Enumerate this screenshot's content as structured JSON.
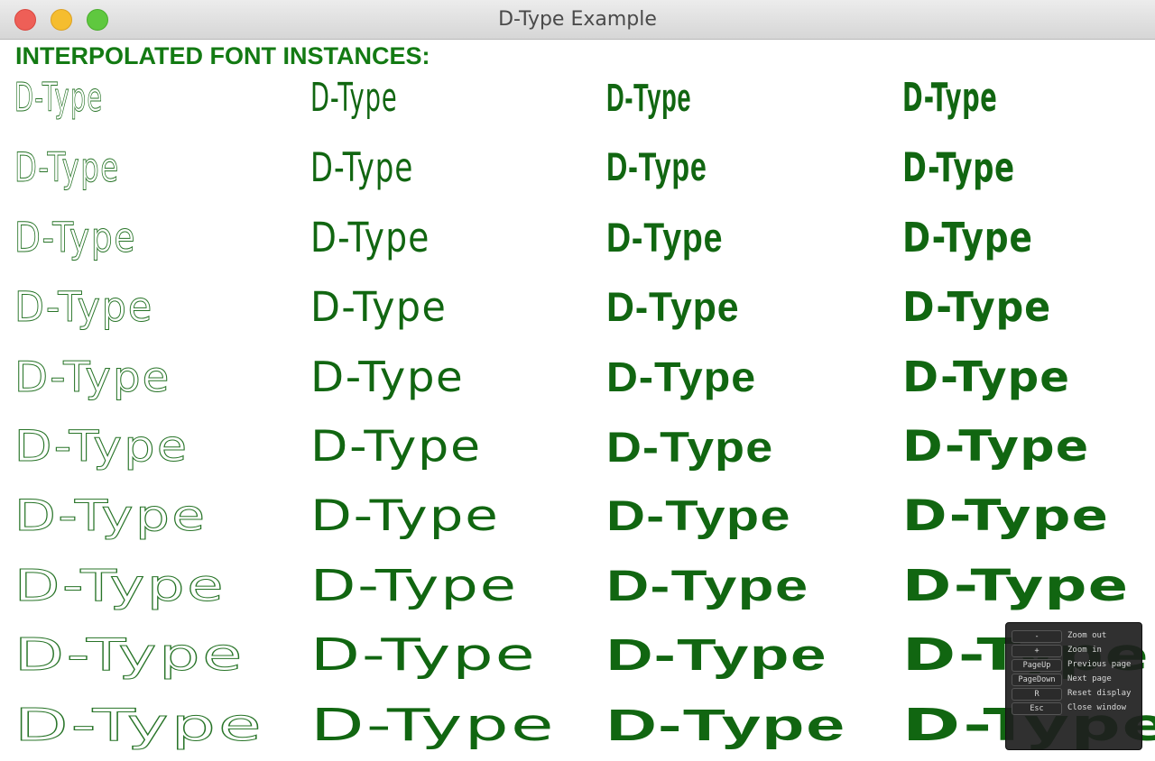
{
  "window": {
    "title": "D-Type Example"
  },
  "heading": "INTERPOLATED FONT INSTANCES:",
  "sample_text": "D-Type",
  "text_color": "#116611",
  "heading_color": "#137a13",
  "help": [
    {
      "key": "-",
      "desc": "Zoom out"
    },
    {
      "key": "+",
      "desc": "Zoom in"
    },
    {
      "key": "PageUp",
      "desc": "Previous page"
    },
    {
      "key": "PageDown",
      "desc": "Next page"
    },
    {
      "key": "R",
      "desc": "Reset display"
    },
    {
      "key": "Esc",
      "desc": "Close window"
    }
  ]
}
